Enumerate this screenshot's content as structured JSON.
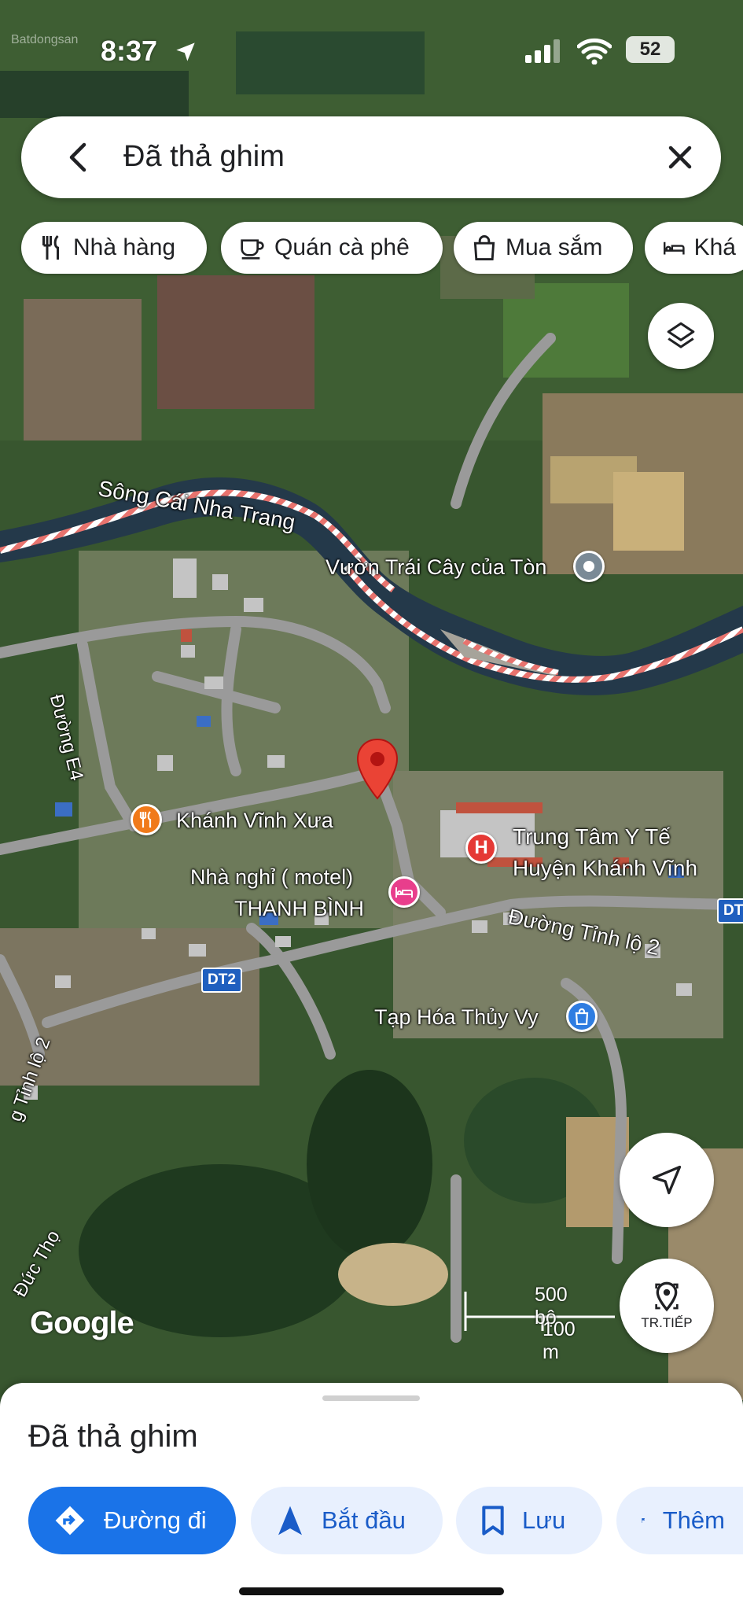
{
  "status_bar": {
    "time": "8:37",
    "battery": "52",
    "watermark": "Batdongsan"
  },
  "search": {
    "text": "Đã thả ghim"
  },
  "chips": [
    {
      "icon": "restaurant-icon",
      "label": "Nhà hàng"
    },
    {
      "icon": "coffee-icon",
      "label": "Quán cà phê"
    },
    {
      "icon": "shopping-bag-icon",
      "label": "Mua sắm"
    },
    {
      "icon": "bed-icon",
      "label": "Khá"
    }
  ],
  "map": {
    "river_label": "Sông Cái Nha Trang",
    "road_e4": "Đường E4",
    "road_tinh_lo_2": "Đường Tỉnh lộ 2",
    "road_tinh_lo_2_left": "g Tỉnh lộ 2",
    "road_duc_tho": "Đức Thọ",
    "road_dt2": "DT2",
    "poi_orchard": "Vườn Trái Cây của Tòn",
    "poi_restaurant": "Khánh Vĩnh Xưa",
    "poi_motel_line1": "Nhà nghỉ ( motel)",
    "poi_motel_line2": "THANH BÌNH",
    "poi_hospital_line1": "Trung Tâm Y Tế",
    "poi_hospital_line2": "Huyện Khánh Vĩnh",
    "poi_grocery": "Tạp Hóa Thủy Vy",
    "scale_top": "500 bộ",
    "scale_bottom": "100 m",
    "google": "Google"
  },
  "buttons": {
    "tr_label": "TR.TIẾP"
  },
  "sheet": {
    "title": "Đã thả ghim",
    "actions": [
      {
        "icon": "directions-icon",
        "label": "Đường đi"
      },
      {
        "icon": "navigation-arrow-icon",
        "label": "Bắt đầu"
      },
      {
        "icon": "bookmark-icon",
        "label": "Lưu"
      },
      {
        "icon": "flag-icon",
        "label": "Thêm"
      }
    ]
  },
  "colors": {
    "accent": "#1a73e8",
    "pin": "#ea4335",
    "river": "#24394a",
    "road": "#9a9a9a",
    "restaurant_pin": "#f07a1a",
    "hotel_pin": "#e83e8c",
    "shopping_pin": "#2f7de1"
  }
}
